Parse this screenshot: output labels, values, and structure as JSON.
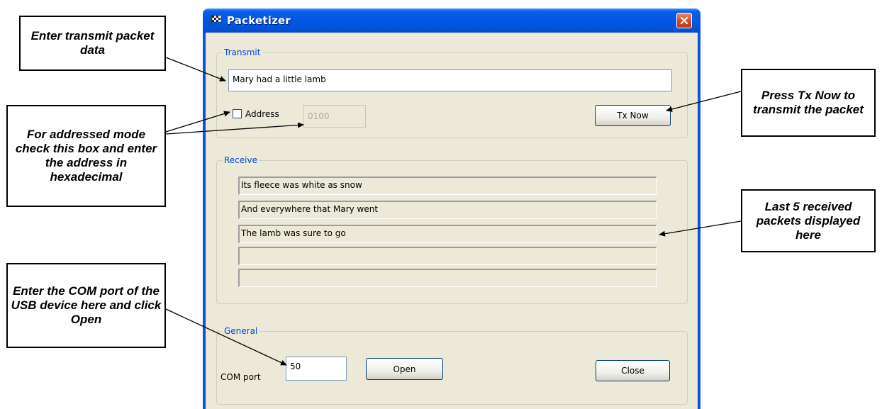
{
  "window": {
    "title": "Packetizer",
    "icon": "checkered-flag-icon",
    "close_icon": "close-icon"
  },
  "transmit": {
    "group_label": "Transmit",
    "packet_value": "Mary had a little lamb",
    "address_label": "Address",
    "address_checked": false,
    "address_value": "0100",
    "tx_button": "Tx Now"
  },
  "receive": {
    "group_label": "Receive",
    "packets": [
      "Its fleece was white as snow",
      "And everywhere that Mary went",
      "The lamb was sure to go",
      "",
      ""
    ]
  },
  "general": {
    "group_label": "General",
    "com_port_label": "COM port",
    "com_port_value": "50",
    "open_button": "Open",
    "close_button": "Close"
  },
  "callouts": {
    "enter_transmit": "Enter transmit packet data",
    "addressed_mode": "For addressed mode check this box and enter the address in hexadecimal",
    "enter_com": "Enter the COM port of the USB device here and click Open",
    "press_tx": "Press Tx Now to transmit the packet",
    "last_received": "Last 5 received packets displayed here"
  },
  "colors": {
    "titlebar": "#0058E6",
    "window_face": "#ECE9D8",
    "group_title": "#0046D5",
    "close_button": "#D2491F"
  }
}
